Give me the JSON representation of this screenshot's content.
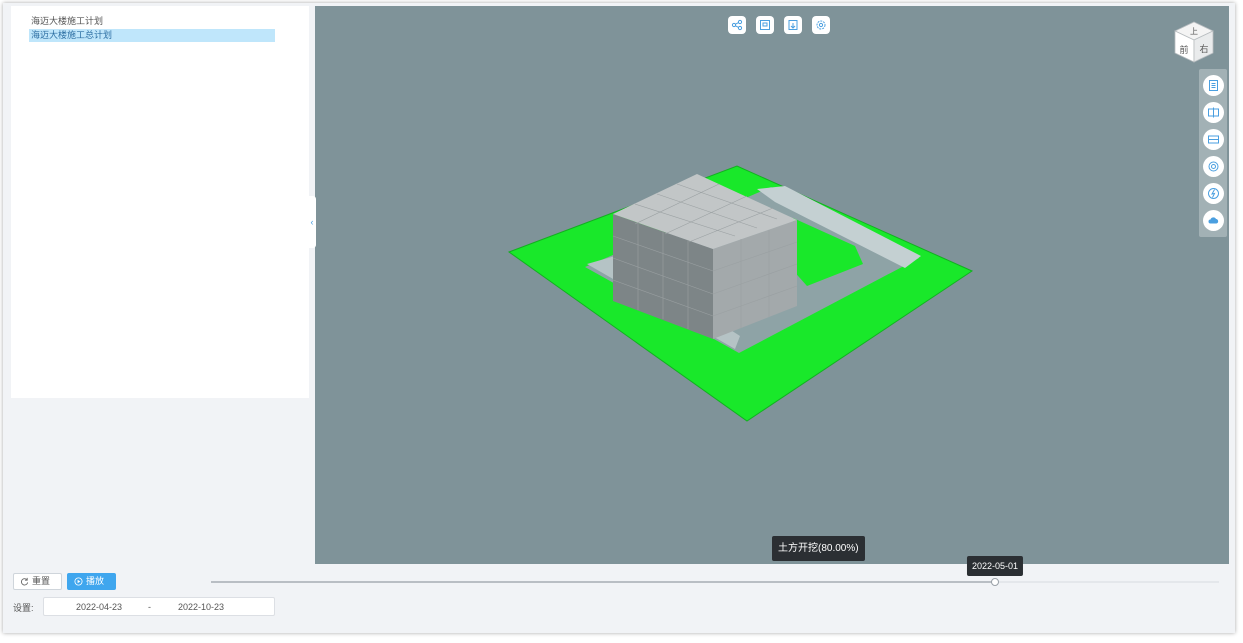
{
  "tree": {
    "items": [
      {
        "label": "海迈大楼施工计划",
        "selected": false
      },
      {
        "label": "海迈大楼施工总计划",
        "selected": true
      }
    ]
  },
  "viewport": {
    "toolbar_icons": [
      "share-icon",
      "image-icon",
      "export-icon",
      "settings-icon"
    ],
    "view_cube": {
      "top": "上",
      "front": "前",
      "right": "右"
    },
    "side_icons": [
      "document-icon",
      "section-icon",
      "layers-icon",
      "rotate-icon",
      "lightning-icon",
      "cloud-icon"
    ],
    "task_tip": "土方开挖(80.00%)"
  },
  "controls": {
    "reset_label": "重置",
    "play_label": "播放",
    "settings_label": "设置:",
    "range_start": "2022-04-23",
    "range_sep": "-",
    "range_end": "2022-10-23",
    "current_date": "2022-05-01",
    "progress": 0.778
  },
  "colors": {
    "accent": "#3fa6ee",
    "viewport_bg": "#7f9399",
    "ground_green": "#19e82a",
    "selected_bg": "#bfe6fb"
  }
}
